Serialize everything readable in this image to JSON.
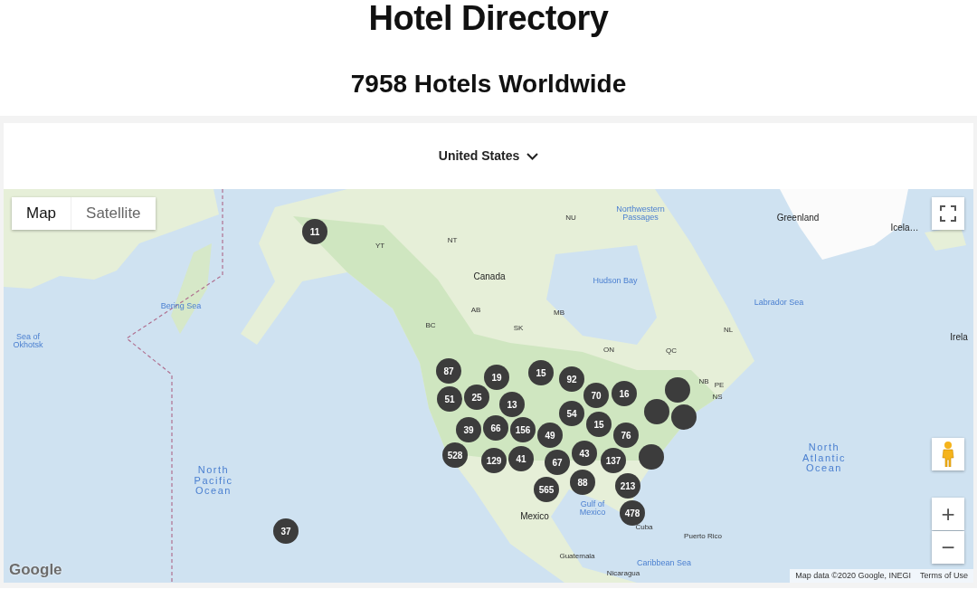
{
  "header": {
    "title": "Hotel Directory",
    "subtitle": "7958 Hotels Worldwide"
  },
  "country_select": {
    "value": "United States"
  },
  "map": {
    "type_tabs": [
      {
        "label": "Map",
        "selected": true
      },
      {
        "label": "Satellite",
        "selected": false
      }
    ],
    "labels": [
      {
        "text": "NU",
        "kind": "region"
      },
      {
        "text": "Northwestern Passages",
        "kind": "water"
      },
      {
        "text": "Greenland",
        "kind": "country"
      },
      {
        "text": "Icela…",
        "kind": "country"
      },
      {
        "text": "NT",
        "kind": "region"
      },
      {
        "text": "YT",
        "kind": "region"
      },
      {
        "text": "Canada",
        "kind": "country"
      },
      {
        "text": "Hudson Bay",
        "kind": "water"
      },
      {
        "text": "Bering Sea",
        "kind": "water"
      },
      {
        "text": "Labrador Sea",
        "kind": "water"
      },
      {
        "text": "MB",
        "kind": "region"
      },
      {
        "text": "AB",
        "kind": "region"
      },
      {
        "text": "BC",
        "kind": "region"
      },
      {
        "text": "SK",
        "kind": "region"
      },
      {
        "text": "Sea of Okhotsk",
        "kind": "water"
      },
      {
        "text": "Irela",
        "kind": "country"
      },
      {
        "text": "NL",
        "kind": "region"
      },
      {
        "text": "ON",
        "kind": "region"
      },
      {
        "text": "QC",
        "kind": "region"
      },
      {
        "text": "NB",
        "kind": "region"
      },
      {
        "text": "PE",
        "kind": "region"
      },
      {
        "text": "NS",
        "kind": "region"
      },
      {
        "text": "North Atlantic Ocean",
        "kind": "ocean"
      },
      {
        "text": "North Pacific Ocean",
        "kind": "ocean"
      },
      {
        "text": "Gulf of Mexico",
        "kind": "water"
      },
      {
        "text": "Mexico",
        "kind": "country"
      },
      {
        "text": "Cuba",
        "kind": "region"
      },
      {
        "text": "Puerto Rico",
        "kind": "region"
      },
      {
        "text": "Guatemala",
        "kind": "region"
      },
      {
        "text": "Caribbean Sea",
        "kind": "water"
      },
      {
        "text": "Nicaragua",
        "kind": "region"
      }
    ],
    "clusters": [
      {
        "count": "11"
      },
      {
        "count": "87"
      },
      {
        "count": "19"
      },
      {
        "count": "15"
      },
      {
        "count": "92"
      },
      {
        "count": "51"
      },
      {
        "count": "25"
      },
      {
        "count": "13"
      },
      {
        "count": "70"
      },
      {
        "count": "16"
      },
      {
        "count": "54"
      },
      {
        "count": "15"
      },
      {
        "count": "39"
      },
      {
        "count": "66"
      },
      {
        "count": "156"
      },
      {
        "count": "49"
      },
      {
        "count": "76"
      },
      {
        "count": "528"
      },
      {
        "count": "129"
      },
      {
        "count": "41"
      },
      {
        "count": "67"
      },
      {
        "count": "43"
      },
      {
        "count": "137"
      },
      {
        "count": "565"
      },
      {
        "count": "88"
      },
      {
        "count": "213"
      },
      {
        "count": "478"
      },
      {
        "count": "37"
      }
    ],
    "zoom_in": "+",
    "zoom_out": "−",
    "logo": "Google",
    "attribution": "Map data ©2020 Google, INEGI",
    "terms": "Terms of Use"
  }
}
